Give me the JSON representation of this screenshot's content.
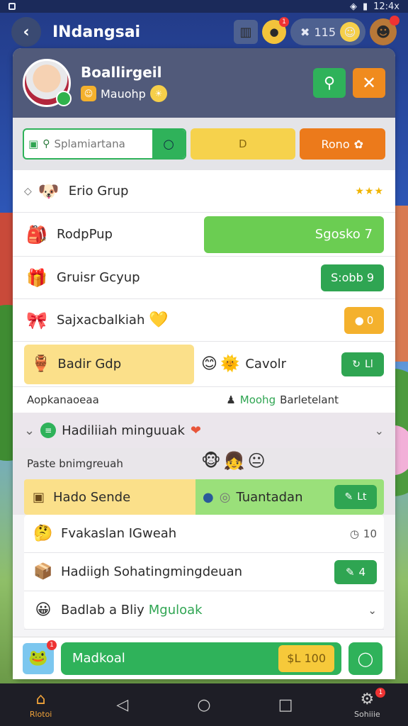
{
  "status_bar": {
    "time": "12:4x"
  },
  "header": {
    "title": "INdangsai",
    "back_icon": "back-arrow-icon",
    "count": "115",
    "notification_badge": "1"
  },
  "profile": {
    "name": "Boallirgeil",
    "subtitle": "Mauohp"
  },
  "toolbar": {
    "search_placeholder": "Splamiartana",
    "middle_label": "D",
    "action_label": "Rono"
  },
  "list": {
    "row1": {
      "label": "Erio Grup",
      "stars": "★★★"
    },
    "row2": {
      "label": "RodpPup",
      "banner": "Sgosko 7"
    },
    "row3": {
      "label": "Gruisr Gcyup",
      "badge": "S:obb 9"
    },
    "row4": {
      "label": "Sajxacbalkiah",
      "badge": "0"
    },
    "row5": {
      "label": "Badir Gdp",
      "mid_label": "Cavolr",
      "badge": "Ll"
    },
    "sub": {
      "left": "Aopkanaoeaa",
      "mid_green": "Moohg",
      "mid": "Barletelant"
    }
  },
  "section": {
    "title": "Hadiliiah minguuak",
    "sub_title": "Paste bnimgreuah",
    "pair_left": "Hado Sende",
    "pair_right": "Tuantadan",
    "pair_badge": "Lt"
  },
  "cards": [
    {
      "label": "Fvakaslan IGweah",
      "right": "10"
    },
    {
      "label": "Hadiigh Sohatingmingdeuan",
      "right": "4"
    },
    {
      "label": "Badlab a Bliy",
      "label_green": "Mguloak"
    }
  ],
  "bottom": {
    "main_label": "Madkoal",
    "price": "$L 100",
    "badge": "1"
  },
  "nav": {
    "home": "Rlotoi",
    "settings": "Sohiiie",
    "settings_badge": "1"
  },
  "colors": {
    "green": "#2fb25a",
    "orange": "#ec7a1b",
    "yellow": "#f6d24c",
    "header_bg": "#515a7a"
  }
}
